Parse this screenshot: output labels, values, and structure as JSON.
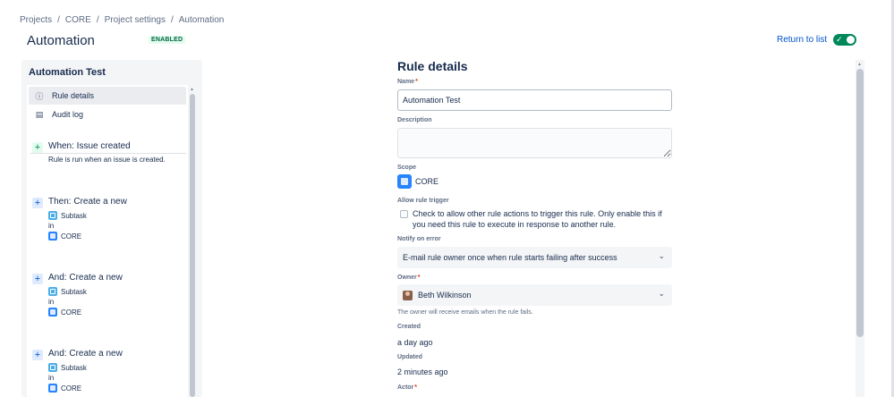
{
  "breadcrumb": [
    "Projects",
    "CORE",
    "Project settings",
    "Automation"
  ],
  "page": {
    "title": "Automation",
    "status": "ENABLED",
    "return_label": "Return to list",
    "toggle_check": "✓"
  },
  "sidebar": {
    "title": "Automation Test",
    "nav": [
      {
        "label": "Rule details",
        "icon": "ⓘ"
      },
      {
        "label": "Audit log",
        "icon": "▤"
      }
    ],
    "trigger": {
      "title": "When: Issue created",
      "desc": "Rule is run when an issue is created."
    },
    "actions": [
      {
        "title": "Then: Create a new",
        "type": "Subtask",
        "in": "in",
        "project": "CORE"
      },
      {
        "title": "And: Create a new",
        "type": "Subtask",
        "in": "in",
        "project": "CORE"
      },
      {
        "title": "And: Create a new",
        "type": "Subtask",
        "in": "in",
        "project": "CORE"
      }
    ]
  },
  "main": {
    "title": "Rule details",
    "name_label": "Name",
    "name_value": "Automation Test",
    "required": "*",
    "description_label": "Description",
    "description_value": "",
    "scope_label": "Scope",
    "scope_value": "CORE",
    "allow_trigger_label": "Allow rule trigger",
    "allow_trigger_text": "Check to allow other rule actions to trigger this rule. Only enable this if you need this rule to execute in response to another rule.",
    "notify_label": "Notify on error",
    "notify_value": "E-mail rule owner once when rule starts failing after success",
    "owner_label": "Owner",
    "owner_value": "Beth Wilkinson",
    "owner_helper": "The owner will receive emails when the rule fails.",
    "created_label": "Created",
    "created_value": "a day ago",
    "updated_label": "Updated",
    "updated_value": "2 minutes ago",
    "actor_label": "Actor"
  },
  "icons": {
    "chevron": "⌄",
    "plus": "+"
  },
  "colors": {
    "accent": "#0052cc",
    "success": "#00875a",
    "text": "#172b4d"
  }
}
